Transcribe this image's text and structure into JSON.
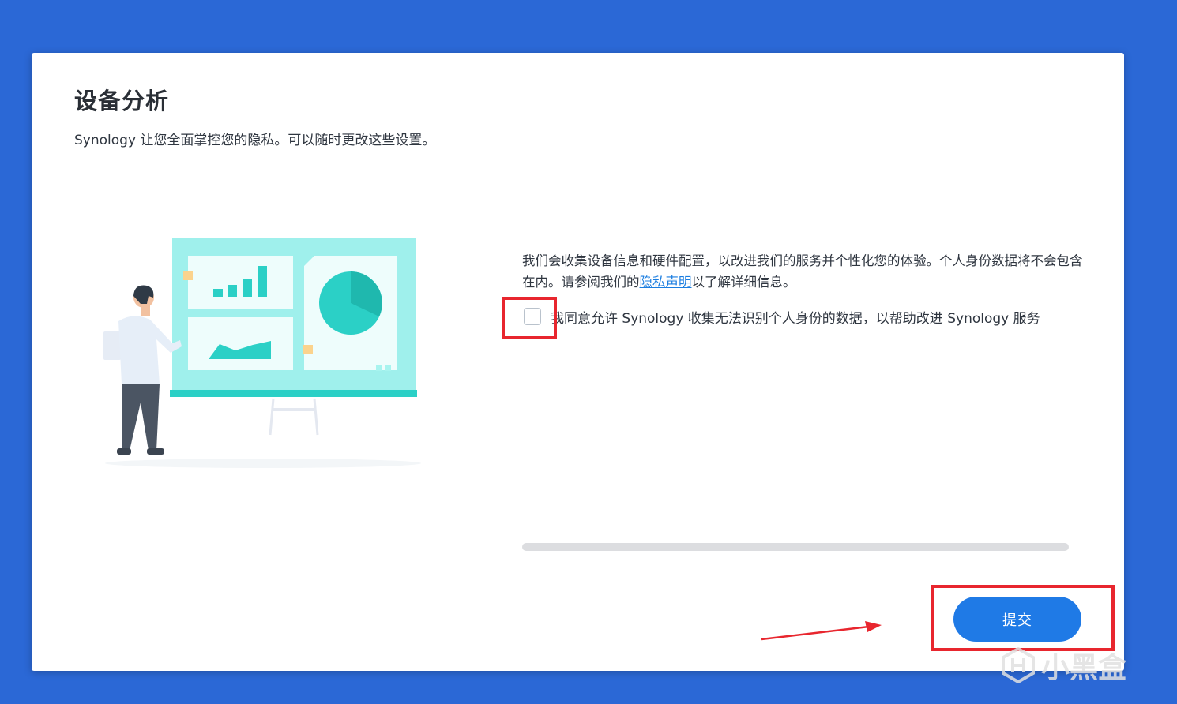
{
  "dialog": {
    "title": "设备分析",
    "subtitle": "Synology 让您全面掌控您的隐私。可以随时更改这些设置。",
    "description_before_link": "我们会收集设备信息和硬件配置，以改进我们的服务并个性化您的体验。个人身份数据将不会包含在内。请参阅我们的",
    "privacy_link": "隐私声明",
    "description_after_link": "以了解详细信息。",
    "agree_label": "我同意允许 Synology 收集无法识别个人身份的数据，以帮助改进 Synology 服务",
    "agree_checked": false,
    "submit_label": "提交"
  },
  "watermark": {
    "text": "小黑盒",
    "icon": "heybox-logo-icon"
  },
  "colors": {
    "background": "#2b68d6",
    "accent": "#1f7ae6",
    "highlight": "#e8262e",
    "illustration_teal": "#2bd0c6"
  }
}
